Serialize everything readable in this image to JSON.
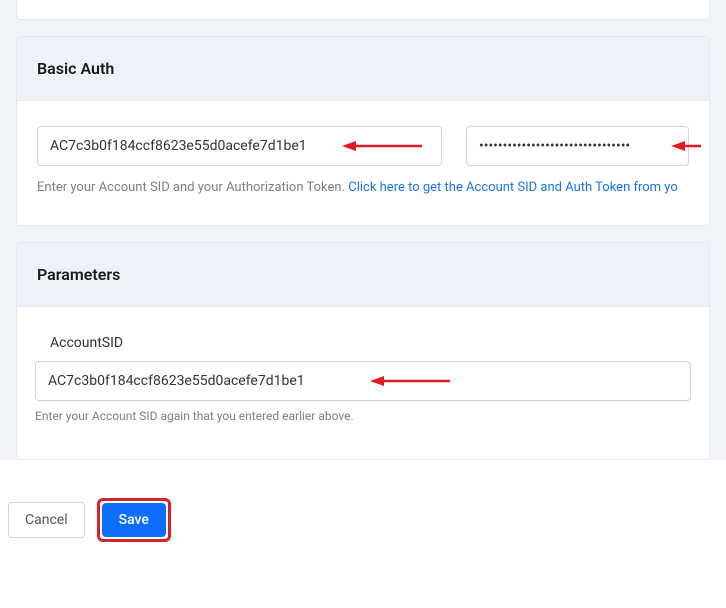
{
  "basic_auth": {
    "title": "Basic Auth",
    "sid_value": "AC7c3b0f184ccf8623e55d0acefe7d1be1",
    "token_value": "••••••••••••••••••••••••••••••••",
    "help_text": "Enter your Account SID and your Authorization Token. ",
    "help_link_text": "Click here to get the Account SID and Auth Token from yo"
  },
  "parameters": {
    "title": "Parameters",
    "account_sid_label": "AccountSID",
    "account_sid_value": "AC7c3b0f184ccf8623e55d0acefe7d1be1",
    "account_sid_help": "Enter your Account SID again that you entered earlier above."
  },
  "buttons": {
    "cancel": "Cancel",
    "save": "Save"
  },
  "colors": {
    "link": "#1a73e8",
    "save_bg": "#0d6efd",
    "highlight_border": "#d8222a",
    "arrow": "#e11b22"
  }
}
